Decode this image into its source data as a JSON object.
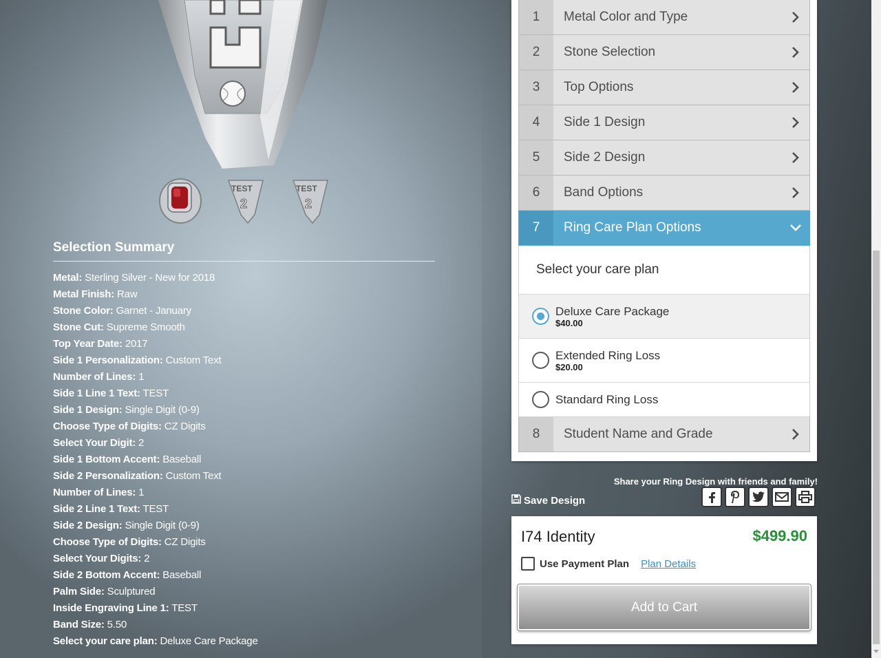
{
  "thumbnails": [
    {
      "name": "ring-top-view"
    },
    {
      "name": "ring-side-1-view",
      "engraving": "TEST"
    },
    {
      "name": "ring-side-2-view",
      "engraving": "TEST"
    }
  ],
  "summary": {
    "title": "Selection Summary",
    "items": [
      {
        "label": "Metal:",
        "value": "Sterling Silver - New for 2018"
      },
      {
        "label": "Metal Finish:",
        "value": "Raw"
      },
      {
        "label": "Stone Color:",
        "value": "Garnet - January"
      },
      {
        "label": "Stone Cut:",
        "value": "Supreme Smooth"
      },
      {
        "label": "Top Year Date:",
        "value": "2017"
      },
      {
        "label": "Side 1 Personalization:",
        "value": "Custom Text"
      },
      {
        "label": "Number of Lines:",
        "value": "1"
      },
      {
        "label": "Side 1 Line 1 Text:",
        "value": "TEST"
      },
      {
        "label": "Side 1 Design:",
        "value": "Single Digit (0-9)"
      },
      {
        "label": "Choose Type of Digits:",
        "value": "CZ Digits"
      },
      {
        "label": "Select Your Digit:",
        "value": "2"
      },
      {
        "label": "Side 1 Bottom Accent:",
        "value": "Baseball"
      },
      {
        "label": "Side 2 Personalization:",
        "value": "Custom Text"
      },
      {
        "label": "Number of Lines:",
        "value": "1"
      },
      {
        "label": "Side 2 Line 1 Text:",
        "value": "TEST"
      },
      {
        "label": "Side 2 Design:",
        "value": "Single Digit (0-9)"
      },
      {
        "label": "Choose Type of Digits:",
        "value": "CZ Digits"
      },
      {
        "label": "Select Your Digits:",
        "value": "2"
      },
      {
        "label": "Side 2 Bottom Accent:",
        "value": "Baseball"
      },
      {
        "label": "Palm Side:",
        "value": "Sculptured"
      },
      {
        "label": "Inside Engraving Line 1:",
        "value": "TEST"
      },
      {
        "label": "Band Size:",
        "value": "5.50"
      },
      {
        "label": "Select your care plan:",
        "value": "Deluxe Care Package"
      }
    ]
  },
  "steps": [
    {
      "num": "1",
      "label": "Metal Color and Type"
    },
    {
      "num": "2",
      "label": "Stone Selection"
    },
    {
      "num": "3",
      "label": "Top Options"
    },
    {
      "num": "4",
      "label": "Side 1 Design"
    },
    {
      "num": "5",
      "label": "Side 2 Design"
    },
    {
      "num": "6",
      "label": "Band Options"
    },
    {
      "num": "7",
      "label": "Ring Care Plan Options",
      "active": true
    },
    {
      "num": "8",
      "label": "Student Name and Grade"
    }
  ],
  "care_plan": {
    "heading": "Select your care plan",
    "options": [
      {
        "name": "Deluxe Care Package",
        "price": "$40.00",
        "selected": true
      },
      {
        "name": "Extended Ring Loss",
        "price": "$20.00",
        "selected": false
      },
      {
        "name": "Standard Ring Loss",
        "price": "",
        "selected": false
      }
    ]
  },
  "share": {
    "text": "Share your Ring Design with friends and family!",
    "icons": [
      "facebook-icon",
      "pinterest-icon",
      "twitter-icon",
      "email-icon",
      "print-icon"
    ]
  },
  "save_label": "Save Design",
  "cart": {
    "product": "I74 Identity",
    "price": "$499.90",
    "payment_plan_label": "Use Payment Plan",
    "plan_details_link": "Plan Details",
    "add_to_cart": "Add to Cart"
  },
  "colors": {
    "accent": "#57a8cf",
    "price_green": "#279136"
  }
}
